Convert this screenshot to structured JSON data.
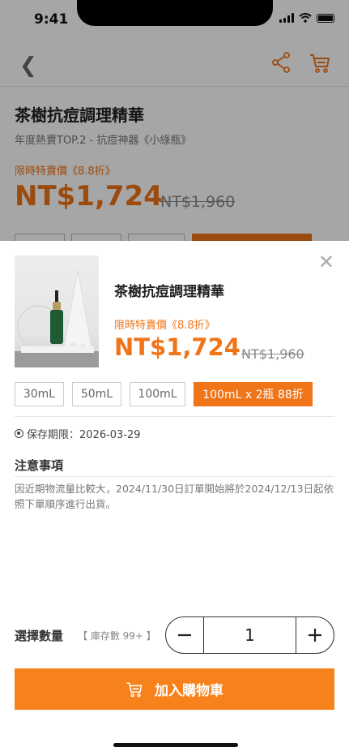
{
  "status_bar": {
    "time": "9:41"
  },
  "background_page": {
    "title": "茶樹抗痘調理精華",
    "subtitle": "年度熱賣TOP.2 - 抗痘神器《小綠瓶》",
    "promo_label": "限時特賣價《8.8折》",
    "price": "NT$1,724",
    "original_price": "NT$1,960"
  },
  "sheet": {
    "product_name": "茶樹抗痘調理精華",
    "promo_label": "限時特賣價《8.8折》",
    "price": "NT$1,724",
    "original_price": "NT$1,960",
    "options": [
      {
        "label": "30mL",
        "selected": false
      },
      {
        "label": "50mL",
        "selected": false
      },
      {
        "label": "100mL",
        "selected": false
      },
      {
        "label": "100mL x 2瓶 88折",
        "selected": true
      }
    ],
    "expiry": "保存期限：2026-03-29",
    "notes_title": "注意事項",
    "notes_body": "因近期物流量比較大，2024/11/30日訂單開始將於2024/12/13日起依照下單順序進行出貨。",
    "quantity_label": "選擇數量",
    "stock_label": "【 庫存數 99+ 】",
    "quantity_value": "1",
    "add_to_cart_label": "加入購物車"
  },
  "colors": {
    "accent": "#f07418",
    "button": "#f7821b"
  }
}
